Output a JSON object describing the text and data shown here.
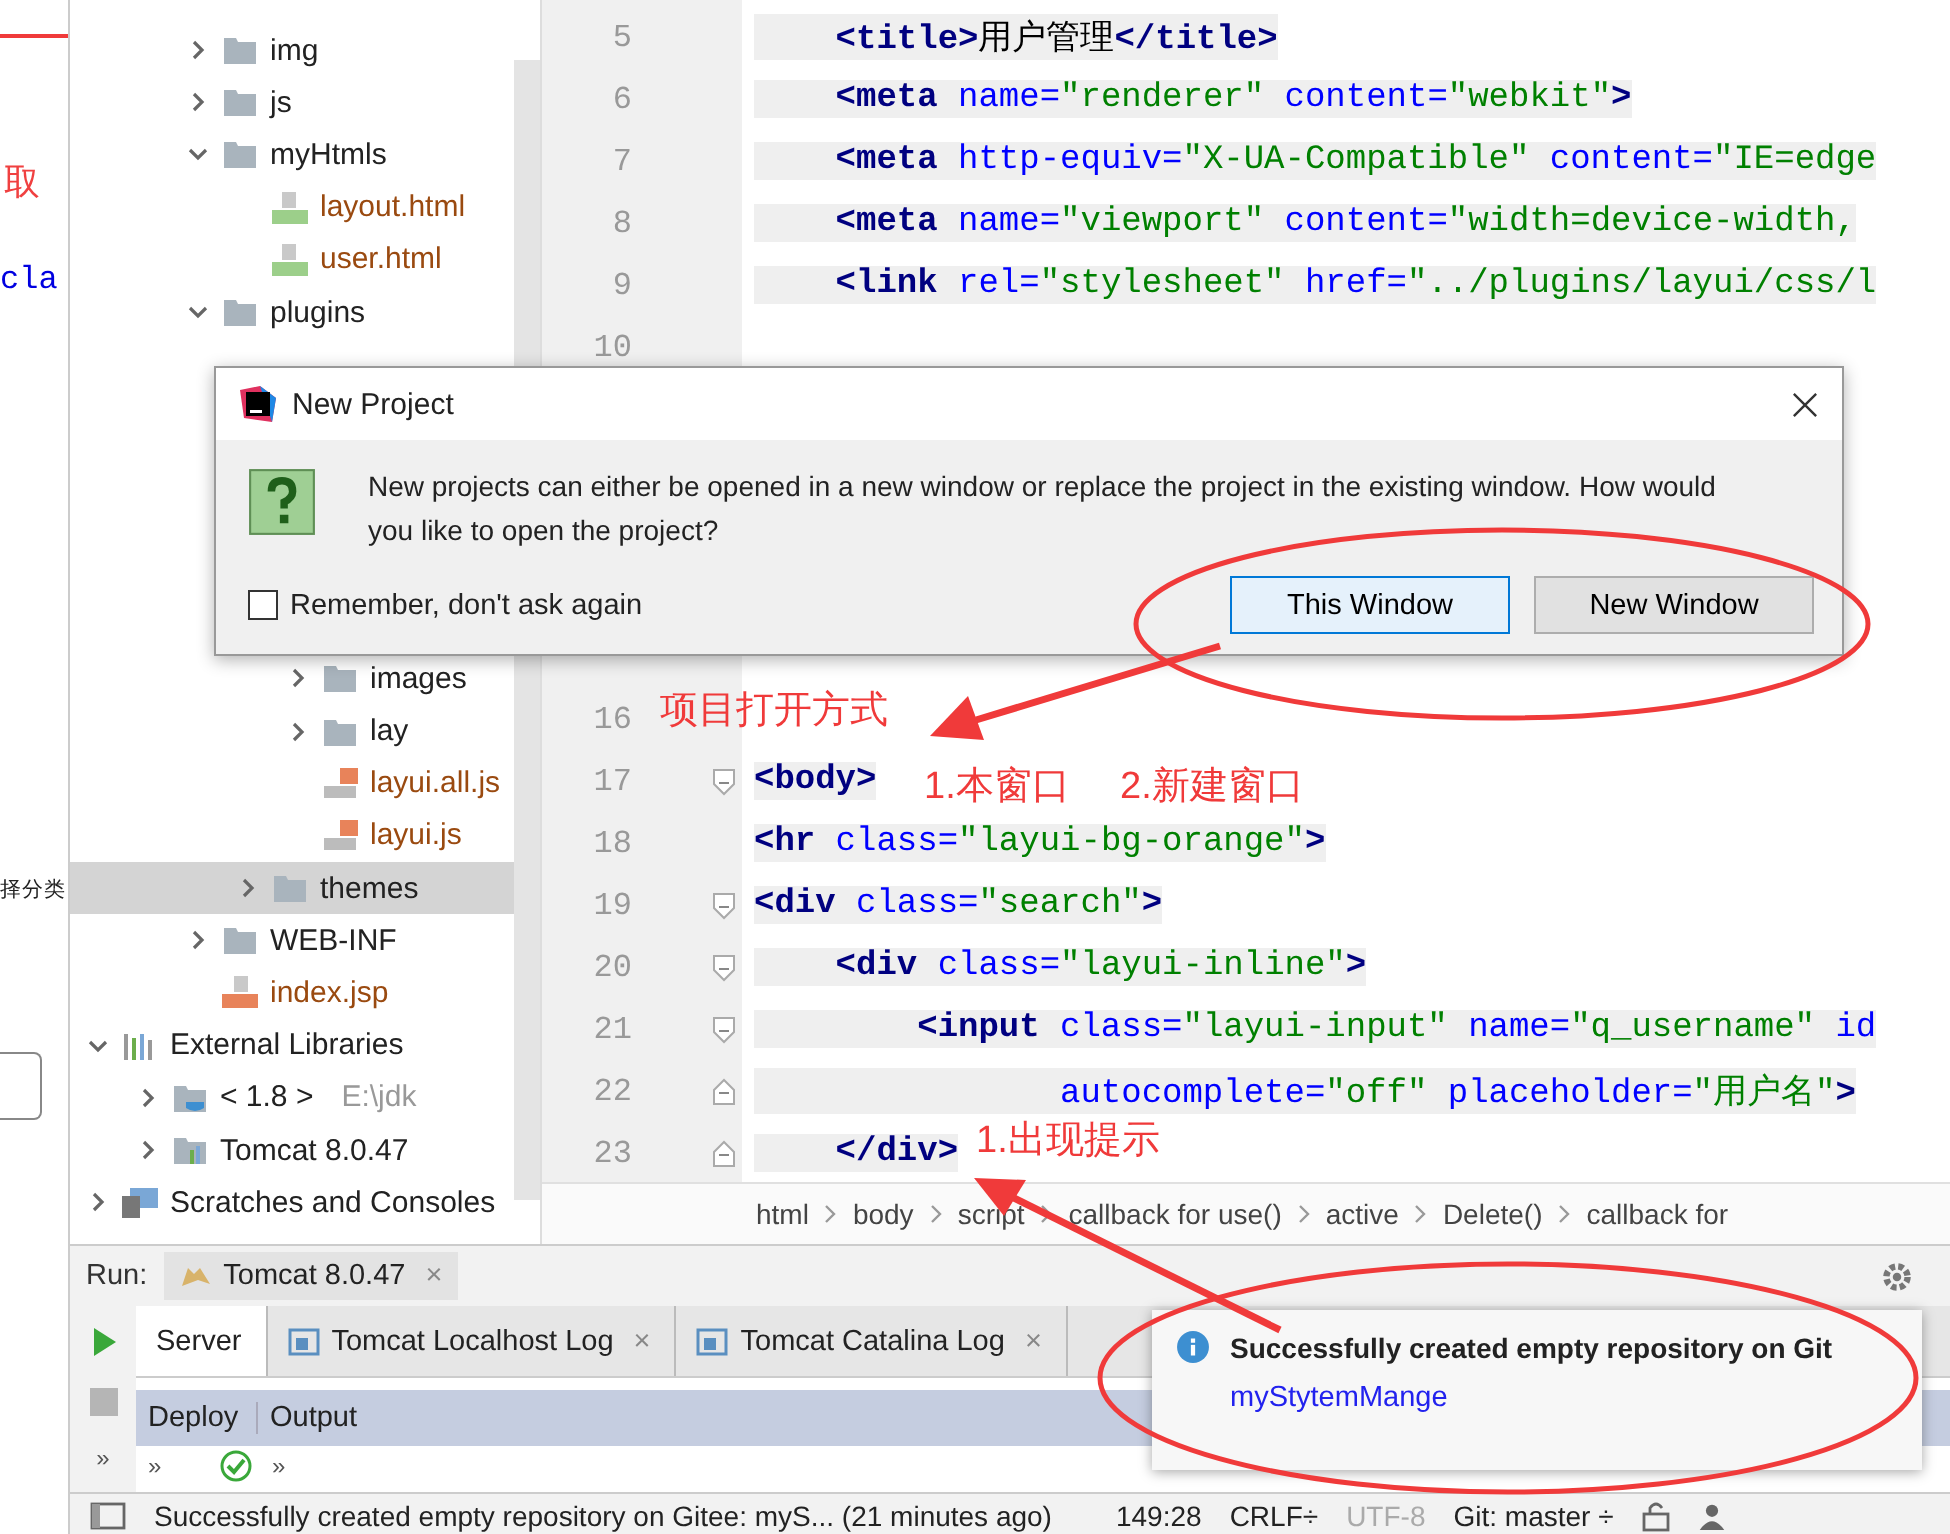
{
  "left_window": {
    "fragments": [
      {
        "text": "取",
        "kind": "red"
      },
      {
        "text": "cla",
        "kind": "code"
      },
      {
        "text": "择分类",
        "kind": "plain"
      }
    ]
  },
  "project_tree": {
    "items": [
      {
        "kind": "offscreen",
        "children": [
          {
            "kind": "offscreen",
            "children": [
              {
                "label": "img",
                "kind": "folder",
                "expanded": false,
                "selected": false
              },
              {
                "label": "js",
                "kind": "folder",
                "expanded": false,
                "selected": false
              },
              {
                "label": "myHtmls",
                "kind": "folder",
                "expanded": true,
                "selected": false,
                "children": [
                  {
                    "label": "layout.html",
                    "kind": "html",
                    "color": "#9a4a10",
                    "selected": false
                  },
                  {
                    "label": "user.html",
                    "kind": "html",
                    "color": "#9a4a10",
                    "selected": false
                  }
                ]
              },
              {
                "label": "plugins",
                "kind": "folder",
                "expanded": true,
                "selected": false,
                "children": [
                  {
                    "kind": "covered"
                  },
                  {
                    "kind": "covered"
                  },
                  {
                    "kind": "covered"
                  },
                  {
                    "kind": "covered"
                  },
                  {
                    "kind": "covered"
                  },
                  {
                    "kind": "covered",
                    "children": [
                      {
                        "label": "images",
                        "kind": "folder",
                        "expanded": false,
                        "selected": false
                      },
                      {
                        "label": "lay",
                        "kind": "folder",
                        "expanded": false,
                        "selected": false
                      },
                      {
                        "label": "layui.all.js",
                        "kind": "js",
                        "color": "#9a4a10",
                        "selected": false
                      },
                      {
                        "label": "layui.js",
                        "kind": "js",
                        "color": "#9a4a10",
                        "selected": false
                      }
                    ]
                  },
                  {
                    "label": "themes",
                    "kind": "folder",
                    "expanded": false,
                    "selected": true
                  }
                ]
              },
              {
                "label": "WEB-INF",
                "kind": "folder",
                "expanded": false,
                "selected": false
              },
              {
                "label": "index.jsp",
                "kind": "jsp",
                "color": "#9a4a10",
                "selected": false
              }
            ]
          }
        ]
      },
      {
        "label": "External Libraries",
        "kind": "library",
        "expanded": true,
        "selected": false,
        "children": [
          {
            "label": "< 1.8 >",
            "secondary": "E:\\jdk",
            "kind": "jdk",
            "expanded": false,
            "selected": false
          },
          {
            "label": "Tomcat 8.0.47",
            "kind": "tomcat",
            "expanded": false,
            "selected": false
          }
        ]
      },
      {
        "label": "Scratches and Consoles",
        "kind": "scratches",
        "expanded": false,
        "selected": false
      }
    ]
  },
  "editor": {
    "lines": [
      {
        "num": "5",
        "tokens": [
          {
            "t": "    <title>",
            "kind": "tag"
          },
          {
            "t": "用户管理",
            "kind": "text"
          },
          {
            "t": "</title>",
            "kind": "tag"
          }
        ]
      },
      {
        "num": "6",
        "tokens": [
          {
            "t": "    <meta",
            "kind": "tag"
          },
          {
            "t": " name=",
            "kind": "attr"
          },
          {
            "t": "\"renderer\"",
            "kind": "str"
          },
          {
            "t": " content=",
            "kind": "attr"
          },
          {
            "t": "\"webkit\"",
            "kind": "str"
          },
          {
            "t": ">",
            "kind": "tag"
          }
        ]
      },
      {
        "num": "7",
        "tokens": [
          {
            "t": "    <meta",
            "kind": "tag"
          },
          {
            "t": " http-equiv=",
            "kind": "attr"
          },
          {
            "t": "\"X-UA-Compatible\"",
            "kind": "str"
          },
          {
            "t": " content=",
            "kind": "attr"
          },
          {
            "t": "\"IE=edge",
            "kind": "str"
          }
        ]
      },
      {
        "num": "8",
        "tokens": [
          {
            "t": "    <meta",
            "kind": "tag"
          },
          {
            "t": " name=",
            "kind": "attr"
          },
          {
            "t": "\"viewport\"",
            "kind": "str"
          },
          {
            "t": " content=",
            "kind": "attr"
          },
          {
            "t": "\"width=device-width,",
            "kind": "str"
          }
        ]
      },
      {
        "num": "9",
        "tokens": [
          {
            "t": "    <link",
            "kind": "tag"
          },
          {
            "t": " rel=",
            "kind": "attr"
          },
          {
            "t": "\"stylesheet\"",
            "kind": "str"
          },
          {
            "t": " href=",
            "kind": "attr"
          },
          {
            "t": "\"../plugins/layui/css/l",
            "kind": "str"
          }
        ]
      },
      {
        "num": "10"
      },
      {
        "kind": "covered"
      },
      {
        "kind": "covered"
      },
      {
        "kind": "covered"
      },
      {
        "kind": "covered"
      },
      {
        "kind": "covered"
      },
      {
        "num": "16"
      },
      {
        "num": "17",
        "kind": "fold_start",
        "tokens": [
          {
            "t": "<body>",
            "kind": "tag"
          }
        ]
      },
      {
        "num": "18",
        "tokens": [
          {
            "t": "<hr",
            "kind": "tag"
          },
          {
            "t": " class=",
            "kind": "attr"
          },
          {
            "t": "\"layui-bg-orange\"",
            "kind": "str"
          },
          {
            "t": ">",
            "kind": "tag"
          }
        ]
      },
      {
        "num": "19",
        "kind": "fold_start",
        "tokens": [
          {
            "t": "<div",
            "kind": "tag"
          },
          {
            "t": " class=",
            "kind": "attr"
          },
          {
            "t": "\"search\"",
            "kind": "str"
          },
          {
            "t": ">",
            "kind": "tag"
          }
        ]
      },
      {
        "num": "20",
        "kind": "fold_start",
        "tokens": [
          {
            "t": "    <div",
            "kind": "tag"
          },
          {
            "t": " class=",
            "kind": "attr"
          },
          {
            "t": "\"layui-inline\"",
            "kind": "str"
          },
          {
            "t": ">",
            "kind": "tag"
          }
        ]
      },
      {
        "num": "21",
        "kind": "fold_start",
        "tokens": [
          {
            "t": "        <input",
            "kind": "tag"
          },
          {
            "t": " class=",
            "kind": "attr"
          },
          {
            "t": "\"layui-input\"",
            "kind": "str"
          },
          {
            "t": " name=",
            "kind": "attr"
          },
          {
            "t": "\"q_username\"",
            "kind": "str"
          },
          {
            "t": " id",
            "kind": "attr"
          }
        ]
      },
      {
        "num": "22",
        "kind": "fold_end",
        "tokens": [
          {
            "t": "               autocomplete=",
            "kind": "attr"
          },
          {
            "t": "\"off\"",
            "kind": "str"
          },
          {
            "t": " placeholder=",
            "kind": "attr"
          },
          {
            "t": "\"用户名\"",
            "kind": "str"
          },
          {
            "t": ">",
            "kind": "tag"
          }
        ]
      },
      {
        "num": "23",
        "kind": "fold_end",
        "tokens": [
          {
            "t": "    </div>",
            "kind": "tag"
          }
        ]
      }
    ],
    "breadcrumbs": [
      "html",
      "body",
      "script",
      "callback for use()",
      "active",
      "Delete()",
      "callback for"
    ]
  },
  "dialog": {
    "title": "New Project",
    "message": "New projects can either be opened in a new window or replace the project in the existing window. How would you like to open the project?",
    "checkbox": {
      "label": "Remember, don't ask again",
      "checked": false
    },
    "buttons": [
      {
        "label": "This Window",
        "focused": true
      },
      {
        "label": "New Window",
        "focused": false
      }
    ]
  },
  "run_panel": {
    "label": "Run:",
    "tab": "Tomcat 8.0.47",
    "close": "×",
    "tabs": [
      {
        "label": "Server",
        "selected": true
      },
      {
        "label": "Tomcat Localhost Log",
        "close": "×",
        "selected": false
      },
      {
        "label": "Tomcat Catalina Log",
        "close": "×",
        "selected": false
      }
    ],
    "columns": [
      "Deploy",
      "Output"
    ],
    "expand": [
      "»",
      "»",
      "»"
    ]
  },
  "notification": {
    "title": "Successfully created empty repository on Git",
    "link": "myStytemMange"
  },
  "status_bar": {
    "message": "Successfully created empty repository on Gitee: myS... (21 minutes ago)",
    "position": "149:28",
    "line_sep": "CRLF÷",
    "encoding": "UTF-8",
    "branch": "Git: master ÷"
  },
  "annotations": {
    "notes": [
      {
        "text": "项目打开方式"
      },
      {
        "text": "1.本窗口"
      },
      {
        "text": "2.新建窗口"
      },
      {
        "text": "1.出现提示"
      }
    ]
  }
}
